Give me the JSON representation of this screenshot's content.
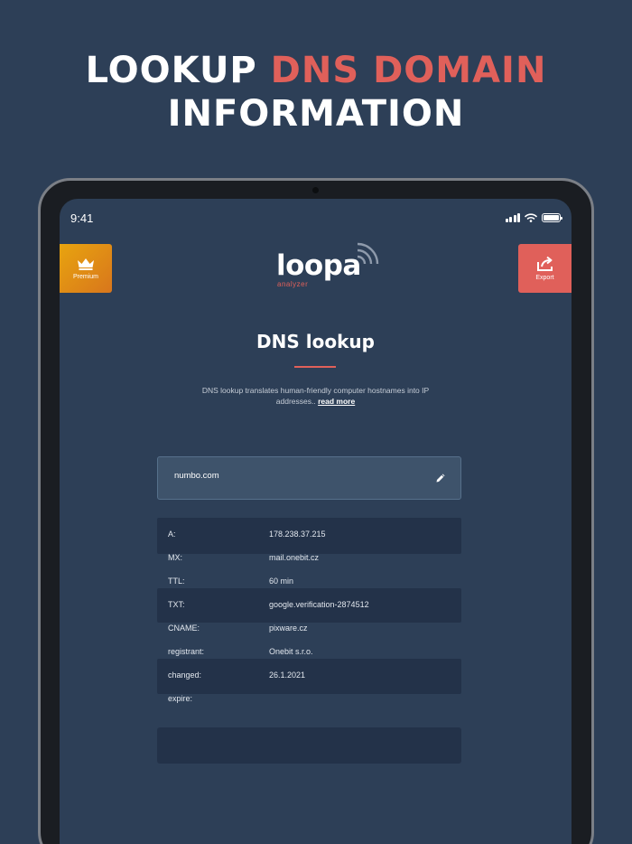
{
  "headline": {
    "part1": "LOOKUP ",
    "accent": "DNS DOMAIN",
    "line2": "INFORMATION"
  },
  "status": {
    "time": "9:41"
  },
  "premium": {
    "label": "Premium",
    "icon": "crown-icon"
  },
  "export": {
    "label": "Export",
    "icon": "share-icon"
  },
  "logo": {
    "word": "loopa",
    "sub": "analyzer"
  },
  "page": {
    "title": "DNS lookup",
    "desc": "DNS lookup translates human-friendly computer hostnames into IP addresses..",
    "read_more": "read more"
  },
  "domain": {
    "value": "numbo.com",
    "edit_icon": "pencil-icon"
  },
  "records": [
    {
      "key": "A:",
      "value": "178.238.37.215"
    },
    {
      "key": "MX:",
      "value": "mail.onebit.cz"
    },
    {
      "key": "TTL:",
      "value": "60 min"
    },
    {
      "key": "TXT:",
      "value": "google.verification-2874512"
    },
    {
      "key": "CNAME:",
      "value": "pixware.cz"
    },
    {
      "key": "registrant:",
      "value": "Onebit s.r.o."
    },
    {
      "key": "changed:",
      "value": "26.1.2021"
    },
    {
      "key": "expire:",
      "value": ""
    }
  ],
  "colors": {
    "background": "#2d3f57",
    "accent": "#e0605a",
    "premium": "#e8a40f",
    "row_shade": "#233249"
  }
}
